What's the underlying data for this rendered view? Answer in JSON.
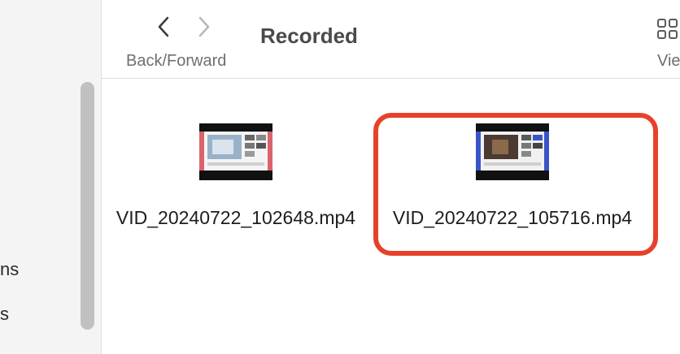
{
  "sidebar": {
    "items": [
      {
        "label": "ns"
      },
      {
        "label": "s"
      }
    ]
  },
  "toolbar": {
    "nav_label": "Back/Forward",
    "title": "Recorded",
    "view_label": "Vie"
  },
  "files": [
    {
      "name": "VID_20240722_102648.mp4",
      "thumb_accent": "#d9646c"
    },
    {
      "name": "VID_20240722_105716.mp4",
      "thumb_accent": "#3a55c7"
    }
  ],
  "colors": {
    "highlight": "#e8412b"
  }
}
